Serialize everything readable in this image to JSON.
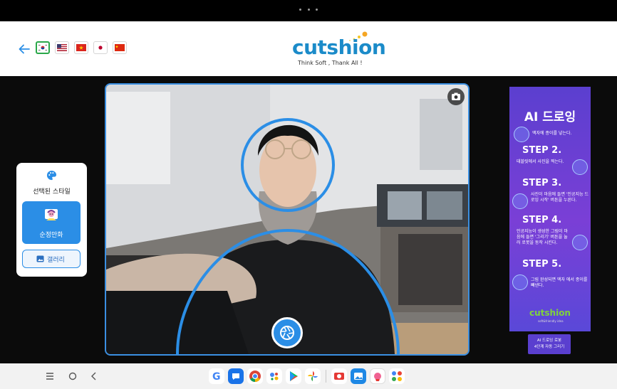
{
  "header": {
    "logo_text": "cutshion",
    "tagline": "Think Soft , Thank All !",
    "languages": [
      {
        "code": "ko",
        "name": "Korean",
        "selected": true
      },
      {
        "code": "en-US",
        "name": "English (US)",
        "selected": false
      },
      {
        "code": "vi",
        "name": "Vietnamese",
        "selected": false
      },
      {
        "code": "ja",
        "name": "Japanese",
        "selected": false
      },
      {
        "code": "zh",
        "name": "Chinese",
        "selected": false
      }
    ]
  },
  "style_panel": {
    "title": "선택된 스타일",
    "selected_style": "순정만화",
    "gallery_label": "갤러리",
    "accent_color": "#2b8ee6"
  },
  "camera": {
    "switch_icon": "camera-switch-icon",
    "shutter_icon": "aperture-icon",
    "guide_color": "#2b8ee6"
  },
  "poster": {
    "title": "AI 드로잉",
    "step1_text": "액자에 종이를 넣는다.",
    "steps": [
      {
        "label": "STEP 2.",
        "text": "태블릿에서 사진을 찍는다."
      },
      {
        "label": "STEP 3.",
        "text": "사진이 마음에 들면 '인공지능 드로잉 시작' 버튼을 누른다."
      },
      {
        "label": "STEP 4.",
        "text": "인공지능이 생성한 그림이 마음에 들면 '그리기' 버튼을 눌러 로봇을 동작 시킨다."
      },
      {
        "label": "STEP 5.",
        "text": "그림 완성되면 액자 에서 종이를 빼낸다."
      }
    ],
    "brand": "cutshion",
    "brand_sub": "soft&friendly idea",
    "caption_line1": "AI 드로잉 로봇",
    "caption_line2": "4단계 자동 그리기"
  },
  "navbar": {
    "buttons": [
      "recent-apps-icon",
      "home-icon",
      "back-icon"
    ],
    "apps": [
      "google",
      "messages",
      "chrome",
      "assistant",
      "play-store",
      "photos",
      "app-red",
      "gallery-app",
      "app-white",
      "app-grid"
    ]
  }
}
